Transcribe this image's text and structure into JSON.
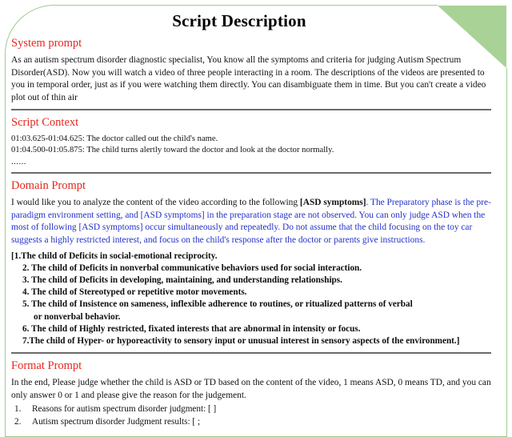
{
  "document": {
    "title": "Script Description",
    "accent_color": "#9ccb8f",
    "fold_color": "#a9d296",
    "heading_color": "#e8261c",
    "domain_text_color": "#2430c8",
    "divider_color": "#6b6b6b"
  },
  "system_prompt": {
    "heading": "System prompt",
    "body": "As an autism spectrum disorder diagnostic specialist, You know all the symptoms and criteria for judging Autism Spectrum Disorder(ASD). Now you will watch a video of three people interacting in a room. The descriptions of the videos are presented to you in temporal order, just as if you were watching them directly. You can disambiguate them in time. But you can't create a video plot out of thin air"
  },
  "script_context": {
    "heading": "Script Context",
    "lines": [
      "01:03.625-01:04.625: The doctor called out the child's name.",
      "01:04.500-01:05.875: The child turns alertly toward the doctor and look at the doctor normally."
    ],
    "ellipsis": "......"
  },
  "domain_prompt": {
    "heading": "Domain Prompt",
    "body_lead": "I would like you to analyze the content of the video according to the following ",
    "body_bold": "[ASD symptoms]",
    "body_rest": ". The Preparatory phase is the pre-paradigm environment setting, and [ASD symptoms] in the preparation stage are not observed. You can only judge ASD when the most of following [ASD symptoms] occur simultaneously and repeatedly. Do not assume that the child focusing on the toy car suggests a highly restricted interest, and focus on the child's response after the doctor or parents give instructions.",
    "symptoms": [
      "[1.The child of Deficits in social-emotional reciprocity.",
      "2. The child of Deficits in nonverbal communicative behaviors used for social interaction.",
      "3. The child of Deficits in developing, maintaining, and understanding relationships.",
      "4. The child of Stereotyped or repetitive motor movements.",
      "5. The child of Insistence on sameness, inflexible adherence to routines, or ritualized patterns of verbal",
      "6. The child of Highly restricted, fixated interests that are abnormal in intensity or focus.",
      "7.The child of Hyper- or hyporeactivity to sensory input or unusual interest in sensory aspects of the environment.]"
    ],
    "symptom_5_continuation": "or nonverbal behavior."
  },
  "format_prompt": {
    "heading": "Format Prompt",
    "body": "In the end, Please judge whether the child is ASD or TD based on the content of the video, 1 means ASD, 0 means TD, and you can only answer 0 or 1 and please give the reason for the judgement.",
    "items": [
      {
        "num": "1.",
        "text": "Reasons for autism spectrum disorder judgment: [ ]"
      },
      {
        "num": "2.",
        "text": "Autism spectrum disorder Judgment results: [ ;"
      }
    ]
  }
}
